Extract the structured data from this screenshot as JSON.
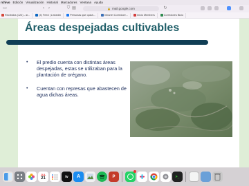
{
  "menubar": {
    "items": [
      "rchivo",
      "Edición",
      "Visualización",
      "Historial",
      "Marcadores",
      "Ventana",
      "Ayuda"
    ]
  },
  "browser": {
    "url": "mail.google.com",
    "bookmarks": [
      {
        "label": "Recibidos (124) - ar...",
        "color": "#d44638"
      },
      {
        "label": "(4) Feed | LinkedIn",
        "color": "#0a66c2"
      },
      {
        "label": "Personas que quizá...",
        "color": "#1877f2"
      },
      {
        "label": "Intranet Corredore...",
        "color": "#3b6fb6"
      },
      {
        "label": "Inicio Members",
        "color": "#d23c3c"
      },
      {
        "label": "Corredores Bicio",
        "color": "#2d8a4e"
      }
    ]
  },
  "slide": {
    "title": "Áreas despejadas cultivables",
    "bullets": [
      "El predio cuenta con distintas áreas despejadas, estas se utilizaban para la plantación de orégano.",
      "Cuentan con represas que abastecen de agua dichas áreas."
    ]
  },
  "dock": {
    "calendar_month": "JUL",
    "calendar_day": "21"
  },
  "colors": {
    "accent_green": "#dfeed7",
    "title_teal": "#1f5e68",
    "bar_navy": "#103e55",
    "bullet_text": "#1a2b5a"
  }
}
